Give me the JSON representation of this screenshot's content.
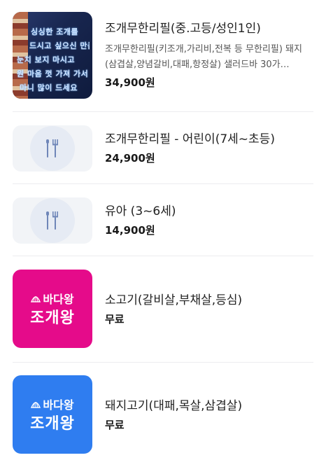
{
  "menu": {
    "items": [
      {
        "name": "조개무한리필(중.고등/성인1인)",
        "description": "조개무한리필(키조개,가리비,전복 등 무한리필) 돼지(삼겹살,양념갈비,대패,항정살) 샐러드바 30가…",
        "price": "34,900원",
        "thumbnail": "store-photo",
        "photo_sign_lines": [
          "싱싱한 조개를",
          "드시고 싶으신 만큼",
          "눈치 보지 마시고",
          "원 마음 껏 가져 가서",
          "마니 많이 드세요"
        ]
      },
      {
        "name": "조개무한리필 - 어린이(7세~초등)",
        "price": "24,900원",
        "thumbnail": "utensils-placeholder"
      },
      {
        "name": "유아 (3~6세)",
        "price": "14,900원",
        "thumbnail": "utensils-placeholder"
      },
      {
        "name": "소고기(갈비살,부채살,등심)",
        "price": "무료",
        "thumbnail": "brand-logo",
        "logo_top": "바다왕",
        "logo_bottom": "조개왕",
        "logo_bg": "#e50b8a"
      },
      {
        "name": "돼지고기(대패,목살,삼겹살)",
        "price": "무료",
        "thumbnail": "brand-logo",
        "logo_top": "바다왕",
        "logo_bottom": "조개왕",
        "logo_bg": "#2f7df0"
      }
    ]
  },
  "colors": {
    "placeholder_bg": "#f2f4f7",
    "placeholder_circle": "#e6ebf4",
    "utensil_icon": "#6f86b8",
    "divider": "#ececef"
  }
}
